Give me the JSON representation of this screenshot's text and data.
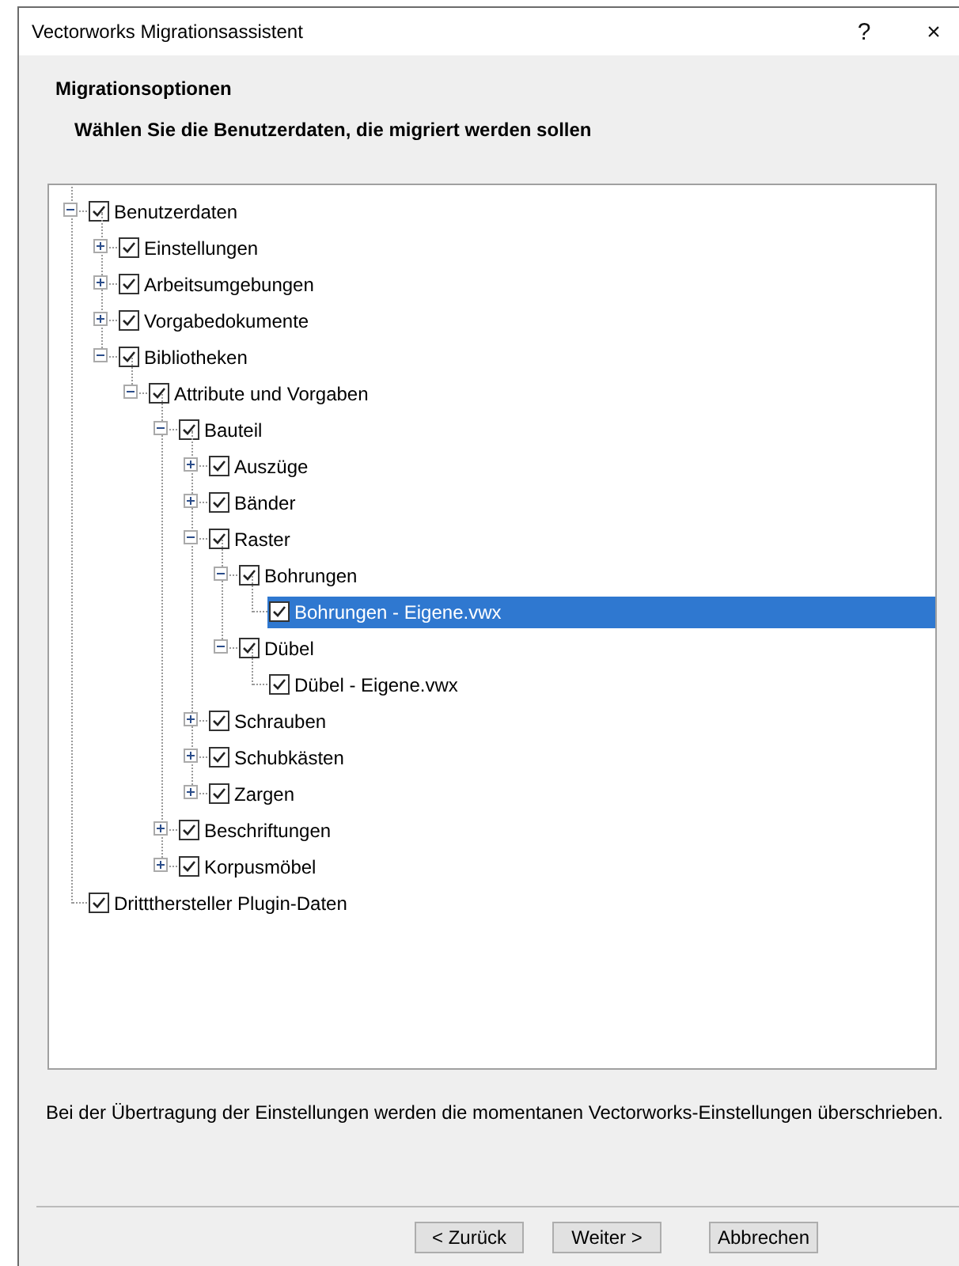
{
  "window": {
    "title": "Vectorworks Migrationsassistent",
    "help": "?",
    "close": "×"
  },
  "header": {
    "title": "Migrationsoptionen",
    "subtitle": "Wählen Sie die Benutzerdaten, die migriert werden sollen"
  },
  "tree": [
    {
      "label": "Benutzerdaten",
      "checked": true,
      "selected": false,
      "expanded": true,
      "children": [
        {
          "label": "Einstellungen",
          "checked": true,
          "selected": false,
          "expanded": false
        },
        {
          "label": "Arbeitsumgebungen",
          "checked": true,
          "selected": false,
          "expanded": false
        },
        {
          "label": "Vorgabedokumente",
          "checked": true,
          "selected": false,
          "expanded": false
        },
        {
          "label": "Bibliotheken",
          "checked": true,
          "selected": false,
          "expanded": true,
          "children": [
            {
              "label": "Attribute und Vorgaben",
              "checked": true,
              "selected": false,
              "expanded": true,
              "children": [
                {
                  "label": "Bauteil",
                  "checked": true,
                  "selected": false,
                  "expanded": true,
                  "children": [
                    {
                      "label": "Auszüge",
                      "checked": true,
                      "selected": false,
                      "expanded": false
                    },
                    {
                      "label": "Bänder",
                      "checked": true,
                      "selected": false,
                      "expanded": false
                    },
                    {
                      "label": "Raster",
                      "checked": true,
                      "selected": false,
                      "expanded": true,
                      "children": [
                        {
                          "label": "Bohrungen",
                          "checked": true,
                          "selected": false,
                          "expanded": true,
                          "children": [
                            {
                              "label": "Bohrungen - Eigene.vwx",
                              "checked": true,
                              "selected": true
                            }
                          ]
                        },
                        {
                          "label": "Dübel",
                          "checked": true,
                          "selected": false,
                          "expanded": true,
                          "children": [
                            {
                              "label": "Dübel - Eigene.vwx",
                              "checked": true,
                              "selected": false
                            }
                          ]
                        }
                      ]
                    },
                    {
                      "label": "Schrauben",
                      "checked": true,
                      "selected": false,
                      "expanded": false
                    },
                    {
                      "label": "Schubkästen",
                      "checked": true,
                      "selected": false,
                      "expanded": false
                    },
                    {
                      "label": "Zargen",
                      "checked": true,
                      "selected": false,
                      "expanded": false
                    }
                  ]
                },
                {
                  "label": "Beschriftungen",
                  "checked": true,
                  "selected": false,
                  "expanded": false
                },
                {
                  "label": "Korpusmöbel",
                  "checked": true,
                  "selected": false,
                  "expanded": false
                }
              ]
            }
          ]
        }
      ]
    },
    {
      "label": "Drittthersteller Plugin-Daten",
      "checked": true,
      "selected": false
    }
  ],
  "note": "Bei der Übertragung der Einstellungen werden die momentanen Vectorworks-Einstellungen überschrieben.",
  "buttons": [
    {
      "label": "< Zurück"
    },
    {
      "label": "Weiter >"
    },
    {
      "label": "Abbrechen"
    }
  ]
}
